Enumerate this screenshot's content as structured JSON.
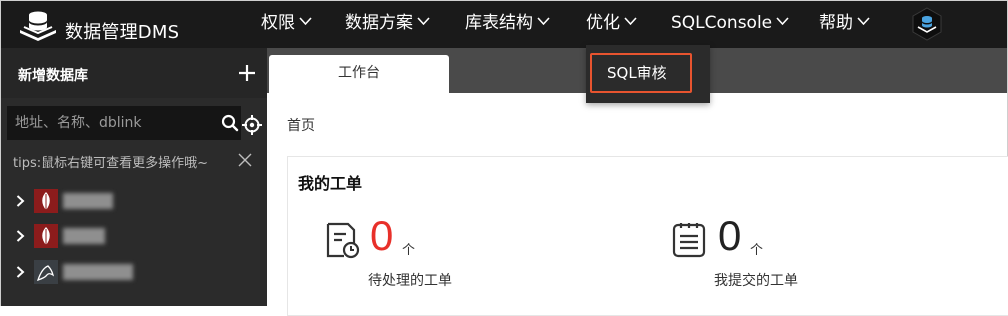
{
  "header": {
    "brand": "数据管理DMS",
    "nav": [
      {
        "label": "权限"
      },
      {
        "label": "数据方案"
      },
      {
        "label": "库表结构"
      },
      {
        "label": "优化"
      },
      {
        "label": "SQLConsole"
      },
      {
        "label": "帮助"
      }
    ]
  },
  "dropdown": {
    "items": [
      {
        "label": "SQL审核"
      }
    ]
  },
  "sidebar": {
    "title": "新增数据库",
    "search_placeholder": "地址、名称、dblink",
    "tips": "tips:鼠标右键可查看更多操作哦~",
    "tree": [
      {
        "icon": "mongodb-icon",
        "name": "redacted"
      },
      {
        "icon": "mongodb-icon",
        "name": "redacted"
      },
      {
        "icon": "mysql-dolphin-icon",
        "name": "redacted"
      }
    ]
  },
  "main": {
    "tab": "工作台",
    "breadcrumb": "首页",
    "card": {
      "title": "我的工单",
      "stats": [
        {
          "value": "0",
          "unit": "个",
          "label": "待处理的工单",
          "icon": "pending-ticket-icon",
          "color": "#e8302a"
        },
        {
          "value": "0",
          "unit": "个",
          "label": "我提交的工单",
          "icon": "submitted-ticket-icon",
          "color": "#222222"
        }
      ]
    }
  },
  "colors": {
    "topbar": "#1a1a1a",
    "sidebar": "#2b2b2b",
    "highlight": "#e8542f",
    "pending": "#e8302a"
  }
}
